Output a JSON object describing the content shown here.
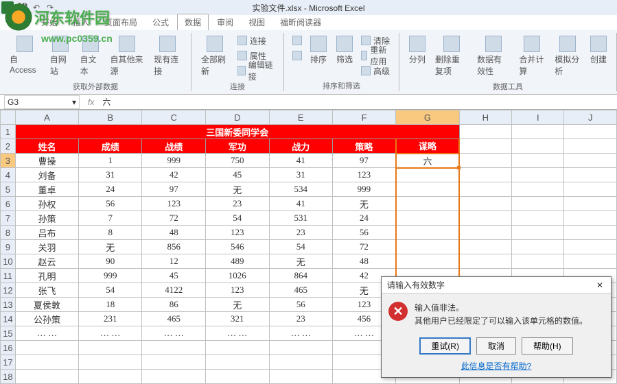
{
  "window": {
    "title": "实验文件.xlsx - Microsoft Excel"
  },
  "logo": {
    "text": "河东软件园",
    "url": "www.pc0359.cn"
  },
  "tabs": [
    "开始",
    "插入",
    "页面布局",
    "公式",
    "数据",
    "审阅",
    "视图",
    "福昕阅读器"
  ],
  "ribbon": {
    "group1": {
      "label": "获取外部数据",
      "btns": [
        "自 Access",
        "自网站",
        "自文本",
        "自其他来源",
        "现有连接"
      ]
    },
    "group2": {
      "label": "连接",
      "refresh": "全部刷新",
      "items": [
        "连接",
        "属性",
        "编辑链接"
      ]
    },
    "group3": {
      "label": "排序和筛选",
      "sort": "排序",
      "filter": "筛选",
      "items": [
        "清除",
        "重新应用",
        "高级"
      ]
    },
    "group4": {
      "label": "数据工具",
      "btns": [
        "分列",
        "删除重复项",
        "数据有效性",
        "合并计算",
        "模拟分析",
        "创建"
      ]
    }
  },
  "namebox": "G3",
  "formula": "六",
  "columns": [
    "A",
    "B",
    "C",
    "D",
    "E",
    "F",
    "G",
    "H",
    "I",
    "J"
  ],
  "sheet": {
    "title": "三国新委同学会",
    "headers": [
      "姓名",
      "成绩",
      "战绩",
      "军功",
      "战力",
      "策略",
      "谋略"
    ],
    "rows": [
      {
        "r": 3,
        "c": [
          "曹操",
          "1",
          "999",
          "750",
          "41",
          "97",
          "六"
        ]
      },
      {
        "r": 4,
        "c": [
          "刘备",
          "31",
          "42",
          "45",
          "31",
          "123",
          ""
        ]
      },
      {
        "r": 5,
        "c": [
          "董卓",
          "24",
          "97",
          "无",
          "534",
          "999",
          ""
        ]
      },
      {
        "r": 6,
        "c": [
          "孙权",
          "56",
          "123",
          "23",
          "41",
          "无",
          ""
        ]
      },
      {
        "r": 7,
        "c": [
          "孙策",
          "7",
          "72",
          "54",
          "531",
          "24",
          ""
        ]
      },
      {
        "r": 8,
        "c": [
          "吕布",
          "8",
          "48",
          "123",
          "23",
          "56",
          ""
        ]
      },
      {
        "r": 9,
        "c": [
          "关羽",
          "无",
          "856",
          "546",
          "54",
          "72",
          ""
        ]
      },
      {
        "r": 10,
        "c": [
          "赵云",
          "90",
          "12",
          "489",
          "无",
          "48",
          ""
        ]
      },
      {
        "r": 11,
        "c": [
          "孔明",
          "999",
          "45",
          "1026",
          "864",
          "42",
          ""
        ]
      },
      {
        "r": 12,
        "c": [
          "张飞",
          "54",
          "4122",
          "123",
          "465",
          "无",
          ""
        ]
      },
      {
        "r": 13,
        "c": [
          "夏侯敦",
          "18",
          "86",
          "无",
          "56",
          "123",
          ""
        ]
      },
      {
        "r": 14,
        "c": [
          "公孙策",
          "231",
          "465",
          "321",
          "23",
          "456",
          ""
        ]
      },
      {
        "r": 15,
        "c": [
          "… …",
          "… …",
          "… …",
          "… …",
          "… …",
          "… …",
          ""
        ]
      }
    ]
  },
  "dialog": {
    "title": "请输入有效数字",
    "line1": "输入值非法。",
    "line2": "其他用户已经限定了可以输入该单元格的数值。",
    "retry": "重试(R)",
    "cancel": "取消",
    "help": "帮助(H)",
    "link": "此信息是否有帮助?"
  },
  "chart_data": {
    "type": "table",
    "title": "三国新委同学会",
    "columns": [
      "姓名",
      "成绩",
      "战绩",
      "军功",
      "战力",
      "策略",
      "谋略"
    ],
    "rows": [
      [
        "曹操",
        1,
        999,
        750,
        41,
        97,
        "六"
      ],
      [
        "刘备",
        31,
        42,
        45,
        31,
        123,
        null
      ],
      [
        "董卓",
        24,
        97,
        "无",
        534,
        999,
        null
      ],
      [
        "孙权",
        56,
        123,
        23,
        41,
        "无",
        null
      ],
      [
        "孙策",
        7,
        72,
        54,
        531,
        24,
        null
      ],
      [
        "吕布",
        8,
        48,
        123,
        23,
        56,
        null
      ],
      [
        "关羽",
        "无",
        856,
        546,
        54,
        72,
        null
      ],
      [
        "赵云",
        90,
        12,
        489,
        "无",
        48,
        null
      ],
      [
        "孔明",
        999,
        45,
        1026,
        864,
        42,
        null
      ],
      [
        "张飞",
        54,
        4122,
        123,
        465,
        "无",
        null
      ],
      [
        "夏侯敦",
        18,
        86,
        "无",
        56,
        123,
        null
      ],
      [
        "公孙策",
        231,
        465,
        321,
        23,
        456,
        null
      ]
    ]
  }
}
